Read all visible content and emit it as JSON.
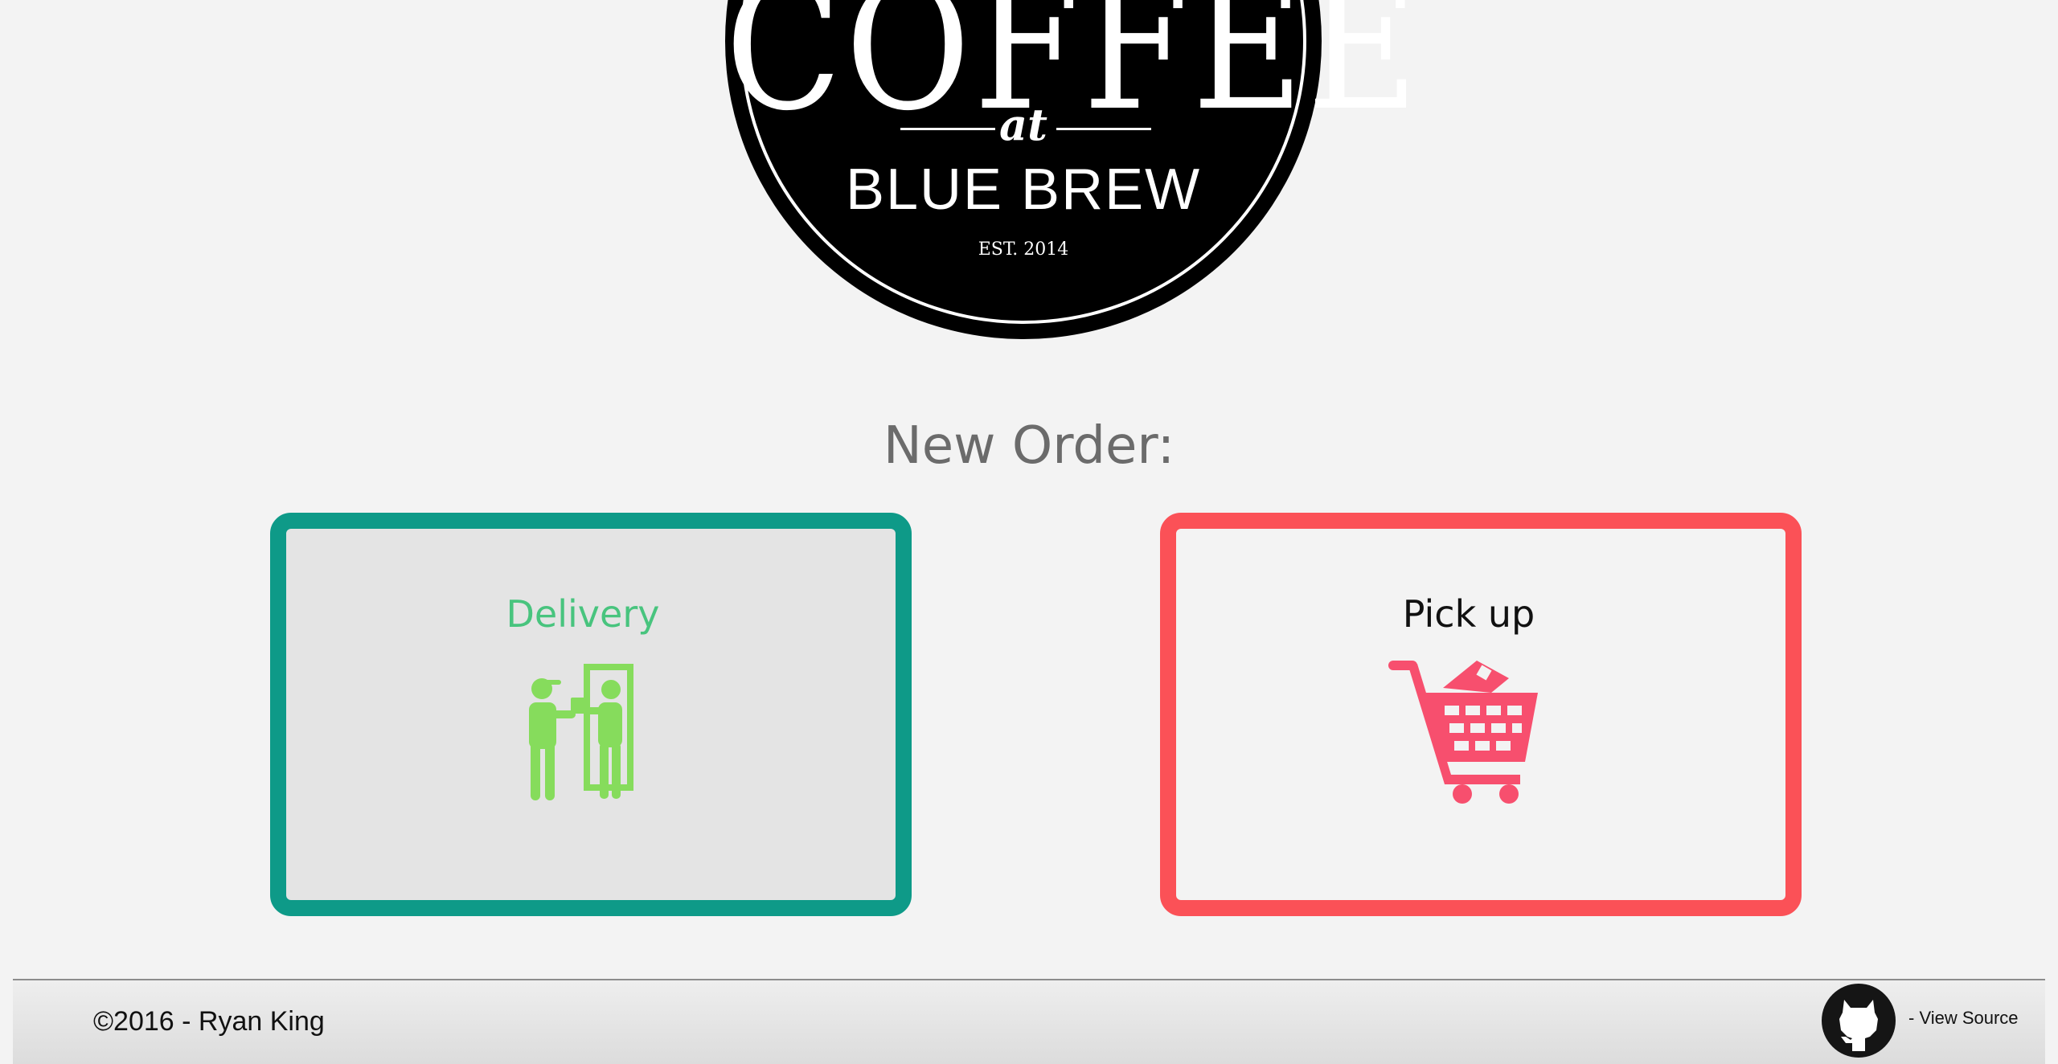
{
  "logo": {
    "line1": "COFFEE",
    "line2": "at",
    "line3": "BLUE BREW",
    "line4": "EST. 2014"
  },
  "heading": "New Order:",
  "options": {
    "delivery": {
      "label": "Delivery",
      "icon": "delivery-person-icon",
      "accent": "#0e9a88",
      "text_color": "#48c47e",
      "icon_color": "#86dc5c"
    },
    "pickup": {
      "label": "Pick up",
      "icon": "shopping-cart-icon",
      "accent": "#fb5157",
      "icon_color": "#f74f6e"
    }
  },
  "footer": {
    "copyright": "©2016 - Ryan King",
    "source_link": "- View Source",
    "source_icon": "github-icon"
  }
}
